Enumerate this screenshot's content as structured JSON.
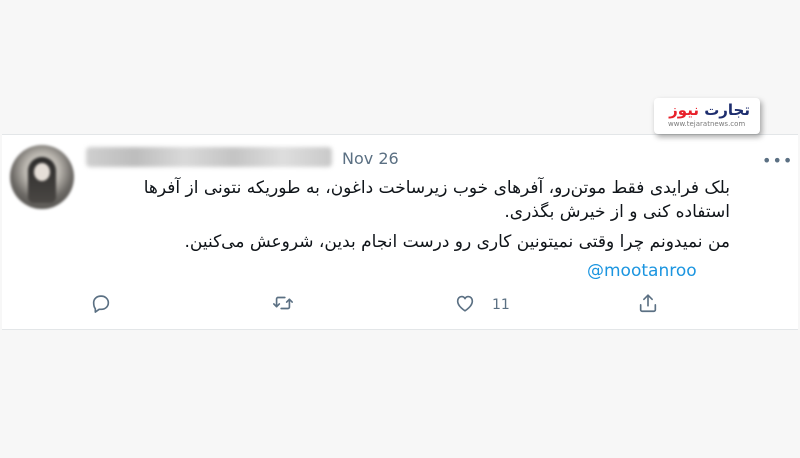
{
  "tweet": {
    "date": "Nov 26",
    "more_label": "•••",
    "lines": [
      "بلک فرایدی فقط موتن‌رو، آفرهای خوب زیرساخت داغون، به طوریکه نتونی از آفرها",
      "استفاده کنی و از خیرش بگذری.",
      "من نمیدونم چرا وقتی نمیتونین کاری رو درست انجام بدین، شروعش می‌کنین."
    ],
    "mention": "@mootanroo",
    "actions": {
      "reply_icon": "reply-icon",
      "retweet_icon": "retweet-icon",
      "like_icon": "heart-icon",
      "like_count": "11",
      "share_icon": "share-icon"
    }
  },
  "watermark": {
    "word_news": "نیوز",
    "word_tejarat": "تجارت",
    "site": "www.tejaratnews.com",
    "colors": {
      "red": "#e8202a",
      "navy": "#1d2d6e"
    }
  },
  "colors": {
    "text": "#0f1419",
    "muted": "#5b7083",
    "link": "#1b95e0"
  }
}
